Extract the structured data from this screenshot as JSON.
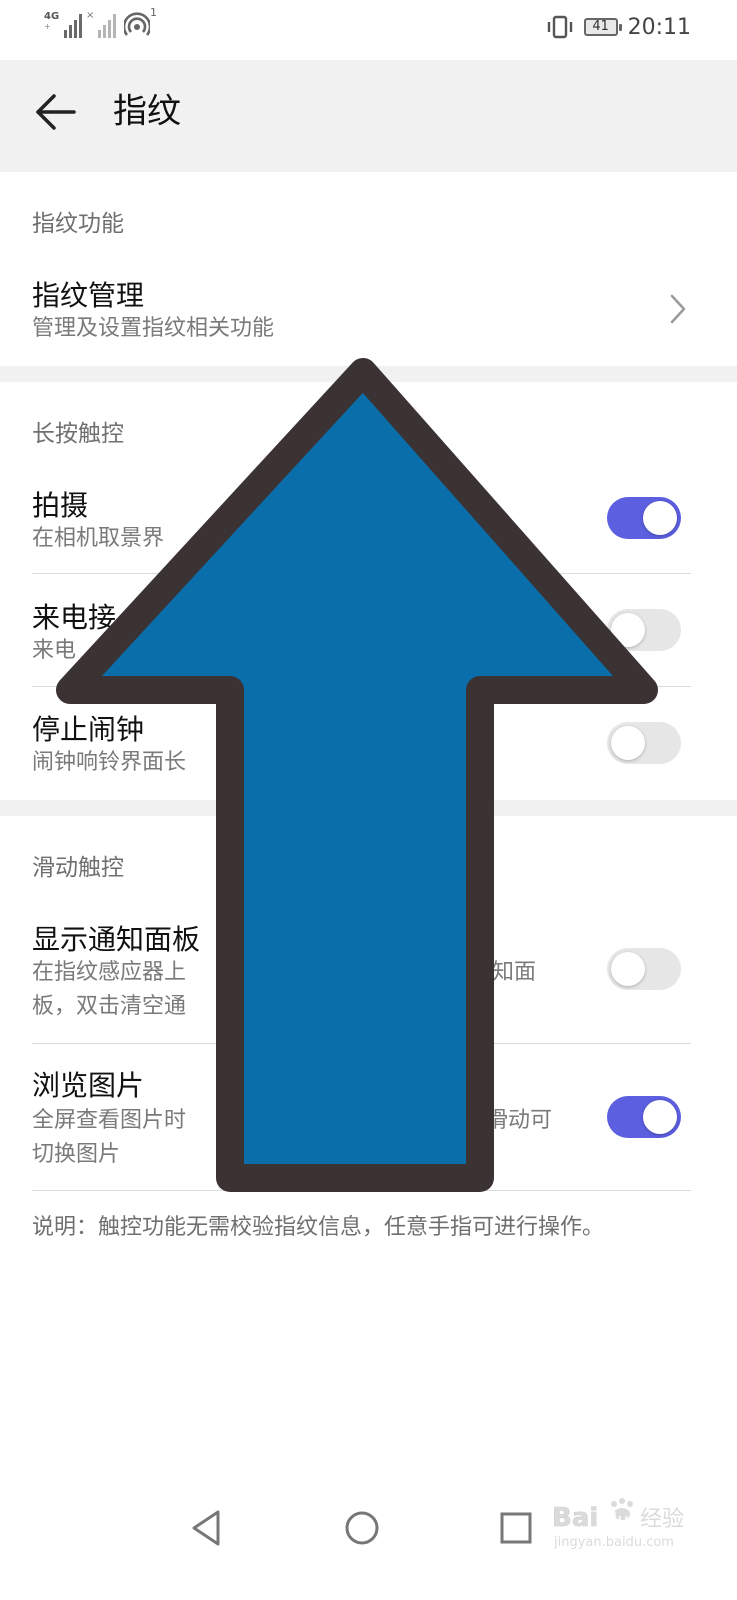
{
  "status_bar": {
    "network_label": "4G",
    "network_sub": "+",
    "sim2_mark": "×",
    "hotspot_count": "1",
    "battery_level": "41",
    "time": "20:11",
    "icons": [
      "signal-icon",
      "signal-weak-icon",
      "hotspot-icon",
      "vibrate-icon",
      "battery-icon"
    ]
  },
  "app_bar": {
    "back_icon": "back-arrow-icon",
    "title": "指纹"
  },
  "sections": {
    "fingerprint_functions": {
      "header": "指纹功能",
      "manage": {
        "title": "指纹管理",
        "subtitle": "管理及设置指纹相关功能"
      }
    },
    "long_press": {
      "header": "长按触控",
      "items": [
        {
          "title": "拍摄",
          "subtitle": "在相机取景界",
          "enabled": true
        },
        {
          "title": "来电接",
          "subtitle": "来电",
          "enabled": false
        },
        {
          "title": "停止闹钟",
          "subtitle": "闹钟响铃界面长",
          "enabled": false
        }
      ]
    },
    "swipe": {
      "header": "滑动触控",
      "items": [
        {
          "title": "显示通知面板",
          "subtitle_1": "在指纹感应器上",
          "subtitle_1b": "知面",
          "subtitle_2": "板，双击清空通",
          "enabled": false
        },
        {
          "title": "浏览图片",
          "subtitle_1": "全屏查看图片时",
          "subtitle_1b": "滑动可",
          "subtitle_2": "切换图片",
          "enabled": true
        }
      ]
    }
  },
  "note": "说明：触控功能无需校验指纹信息，任意手指可进行操作。",
  "overlay": {
    "icon": "up-arrow-icon",
    "fill": "#0a6eab",
    "stroke": "#3b3233"
  },
  "nav_bar": {
    "icons": [
      "nav-back-icon",
      "nav-home-icon",
      "nav-recents-icon"
    ]
  },
  "watermark": {
    "brand": "Bai",
    "paw": "du",
    "label": "经验",
    "url": "jingyan.baidu.com"
  },
  "colors": {
    "toggle_on": "#5c5fe0",
    "toggle_off": "#e6e6e6",
    "band": "#f1f1f1"
  }
}
